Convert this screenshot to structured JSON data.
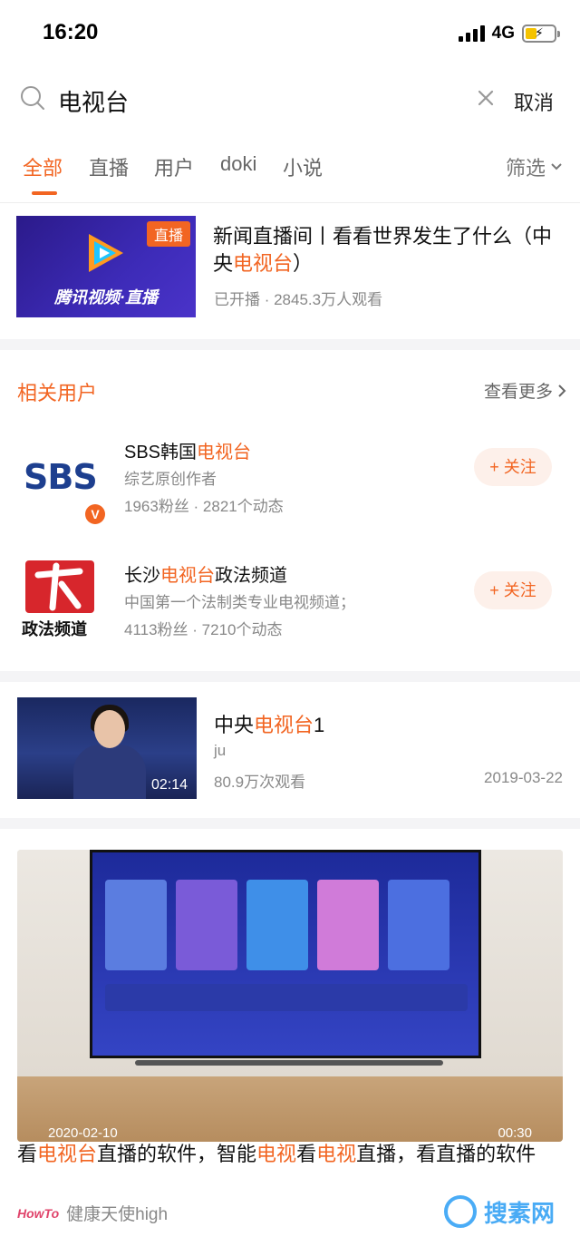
{
  "status": {
    "time": "16:20",
    "network": "4G"
  },
  "search": {
    "query": "电视台",
    "cancel": "取消"
  },
  "tabs": [
    {
      "label": "全部",
      "active": true
    },
    {
      "label": "直播"
    },
    {
      "label": "用户"
    },
    {
      "label": "doki"
    },
    {
      "label": "小说"
    }
  ],
  "filter": "筛选",
  "live": {
    "badge": "直播",
    "brand": "腾讯视频·直播",
    "title_pre": "新闻直播间丨看看世界发生了什么（中央",
    "title_hl": "电视台",
    "title_post": "）",
    "meta": "已开播 · 2845.3万人观看"
  },
  "users_section": {
    "title": "相关用户",
    "see_more": "查看更多",
    "users": [
      {
        "name_pre": "SBS韩国",
        "name_hl": "电视台",
        "name_post": "",
        "desc": "综艺原创作者",
        "stats": "1963粉丝 · 2821个动态",
        "follow": "+ 关注",
        "avatar_text": "SBS"
      },
      {
        "name_pre": "长沙",
        "name_hl": "电视台",
        "name_post": "政法频道",
        "desc": "中国第一个法制类专业电视频道；",
        "stats": "4113粉丝 · 7210个动态",
        "follow": "+ 关注",
        "avatar_text": "政法频道"
      }
    ]
  },
  "video": {
    "title_pre": "中央",
    "title_hl": "电视台",
    "title_post": "1",
    "author": "ju",
    "views": "80.9万次观看",
    "date": "2019-03-22",
    "duration": "02:14"
  },
  "big_video": {
    "date": "2020-02-10",
    "duration": "00:30",
    "title_parts": [
      {
        "text": "看",
        "hl": false
      },
      {
        "text": "电视台",
        "hl": true
      },
      {
        "text": "直播的软件，智能",
        "hl": false
      },
      {
        "text": "电视",
        "hl": true
      },
      {
        "text": "看",
        "hl": false
      },
      {
        "text": "电视",
        "hl": true
      },
      {
        "text": "直播，看直播的软件",
        "hl": false
      }
    ],
    "source_logo": "HowTo",
    "source_name": "健康天使high",
    "watermark": "搜素网"
  },
  "colors": {
    "accent": "#f26522"
  }
}
